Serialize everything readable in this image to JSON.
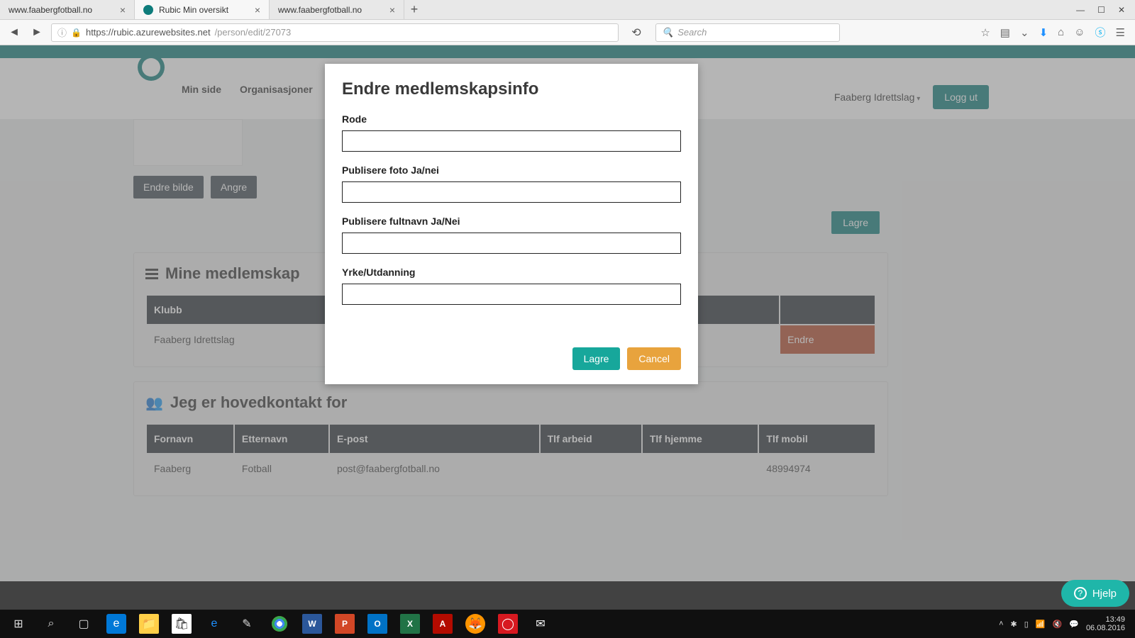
{
  "window": {
    "tabs": [
      {
        "title": "www.faabergfotball.no",
        "active": false
      },
      {
        "title": "Rubic Min oversikt",
        "active": true
      },
      {
        "title": "www.faabergfotball.no",
        "active": false
      }
    ],
    "url_host": "https://rubic.azurewebsites.net",
    "url_path": "/person/edit/27073",
    "search_placeholder": "Search"
  },
  "nav": {
    "items": [
      "Min side",
      "Organisasjoner"
    ],
    "org": "Faaberg Idrettslag",
    "logout": "Logg ut"
  },
  "profile": {
    "change_image": "Endre bilde",
    "undo": "Angre",
    "save": "Lagre"
  },
  "memberships": {
    "title": "Mine medlemskap",
    "columns": [
      "Klubb",
      "",
      ""
    ],
    "rows": [
      {
        "klubb": "Faaberg Idrettslag",
        "action": "Endre"
      }
    ]
  },
  "maincontact": {
    "title": "Jeg er hovedkontakt for",
    "columns": [
      "Fornavn",
      "Etternavn",
      "E-post",
      "Tlf arbeid",
      "Tlf hjemme",
      "Tlf mobil"
    ],
    "rows": [
      {
        "fornavn": "Faaberg",
        "etternavn": "Fotball",
        "epost": "post@faabergfotball.no",
        "arbeid": "",
        "hjemme": "",
        "mobil": "48994974"
      }
    ]
  },
  "modal": {
    "title": "Endre medlemskapsinfo",
    "fields": {
      "rode": {
        "label": "Rode",
        "value": ""
      },
      "foto": {
        "label": "Publisere foto Ja/nei",
        "value": ""
      },
      "fultnavn": {
        "label": "Publisere fultnavn Ja/Nei",
        "value": ""
      },
      "yrke": {
        "label": "Yrke/Utdanning",
        "value": ""
      }
    },
    "save": "Lagre",
    "cancel": "Cancel"
  },
  "help": "Hjelp",
  "taskbar": {
    "time": "13:49",
    "date": "06.08.2016"
  }
}
